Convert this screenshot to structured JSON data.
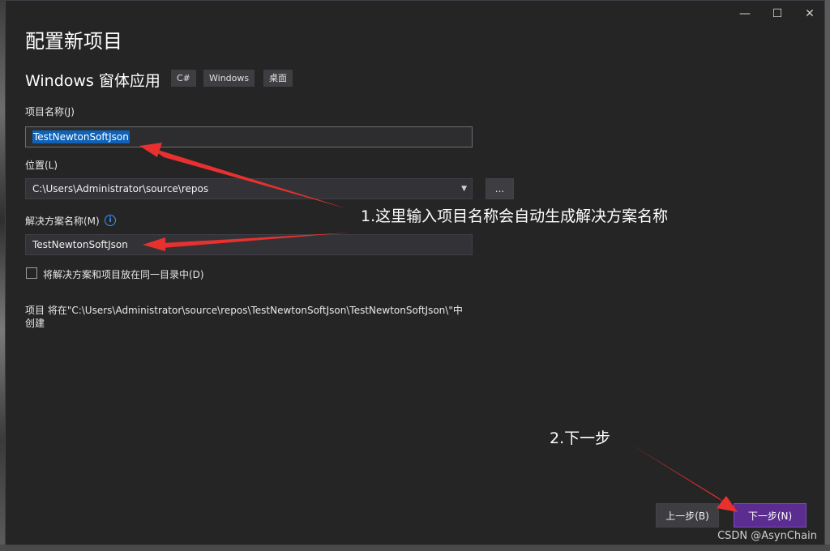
{
  "window": {
    "minimize_glyph": "—",
    "maximize_glyph": "☐",
    "close_glyph": "✕"
  },
  "page": {
    "title": "配置新项目",
    "template_name": "Windows 窗体应用",
    "tags": [
      "C#",
      "Windows",
      "桌面"
    ]
  },
  "form": {
    "project_name_label": "项目名称(J)",
    "project_name_value": "TestNewtonSoftJson",
    "location_label": "位置(L)",
    "location_value": "C:\\Users\\Administrator\\source\\repos",
    "browse_label": "...",
    "solution_name_label": "解决方案名称(M)",
    "solution_name_value": "TestNewtonSoftJson",
    "same_dir_label": "将解决方案和项目放在同一目录中(D)",
    "same_dir_checked": false,
    "creation_path_line1": "项目 将在\"C:\\Users\\Administrator\\source\\repos\\TestNewtonSoftJson\\TestNewtonSoftJson\\\"中",
    "creation_path_line2": "创建"
  },
  "buttons": {
    "back_label": "上一步(B)",
    "next_label": "下一步(N)"
  },
  "annotations": {
    "note1": "1.这里输入项目名称会自动生成解决方案名称",
    "note2": "2.下一步"
  },
  "watermark": "CSDN @AsynChain",
  "colors": {
    "dialog_bg": "#252526",
    "accent_next": "#5c2d91",
    "arrow_red": "#e8312f",
    "selection": "#0e62b8"
  }
}
